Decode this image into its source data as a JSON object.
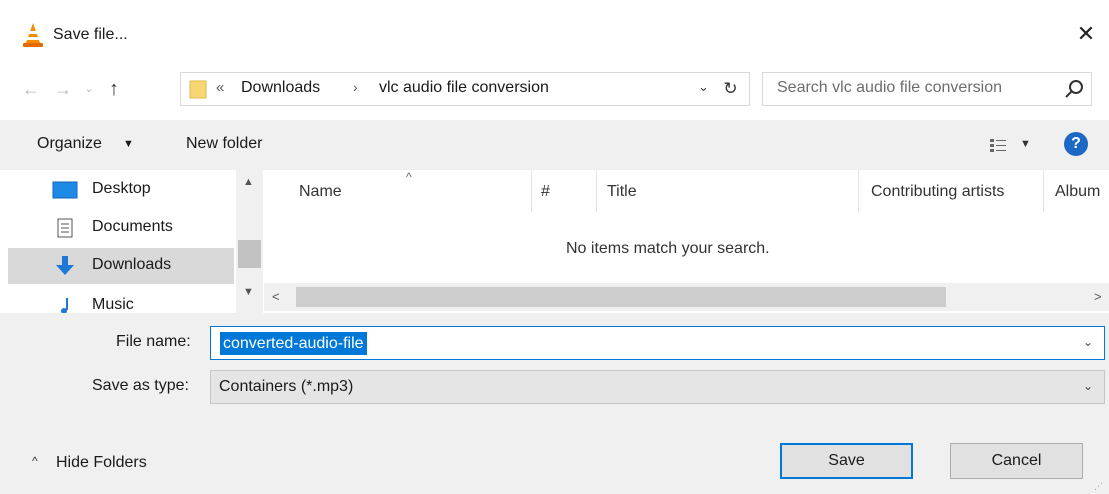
{
  "window": {
    "title": "Save file...",
    "close_glyph": "✕",
    "icon": "vlc-cone-icon"
  },
  "nav": {
    "back_glyph": "←",
    "forward_glyph": "→",
    "recent_glyph": "⌄",
    "up_glyph": "↑"
  },
  "address": {
    "overflow": "«",
    "segments": [
      "Downloads",
      "vlc audio file conversion"
    ],
    "separator": "›",
    "dropdown_glyph": "⌄",
    "refresh_glyph": "↻"
  },
  "search": {
    "placeholder": "Search vlc audio file conversion"
  },
  "toolbar": {
    "organize_label": "Organize",
    "caret": "▼",
    "new_folder_label": "New folder",
    "view_caret": "▼",
    "help_label": "?"
  },
  "navpane": {
    "items": [
      {
        "label": "Desktop",
        "icon": "desktop-icon"
      },
      {
        "label": "Documents",
        "icon": "documents-icon"
      },
      {
        "label": "Downloads",
        "icon": "downloads-icon",
        "selected": true
      },
      {
        "label": "Music",
        "icon": "music-icon"
      }
    ],
    "scroll_up": "▲",
    "scroll_down": "▼"
  },
  "columns": [
    "Name",
    "#",
    "Title",
    "Contributing artists",
    "Album"
  ],
  "empty_message": "No items match your search.",
  "hscroll": {
    "left": "<",
    "right": ">"
  },
  "form": {
    "file_name_label": "File name:",
    "file_name_value": "converted-audio-file",
    "save_type_label": "Save as type:",
    "save_type_value": "Containers (*.mp3)",
    "dd_glyph": "⌄"
  },
  "footer": {
    "hide_folders_caret": "^",
    "hide_folders_label": "Hide Folders",
    "save_label": "Save",
    "cancel_label": "Cancel",
    "grip": "⋰"
  },
  "colors": {
    "accent": "#0078d7",
    "toolbar_bg": "#f0f0f0",
    "help_blue": "#1b69c5"
  }
}
